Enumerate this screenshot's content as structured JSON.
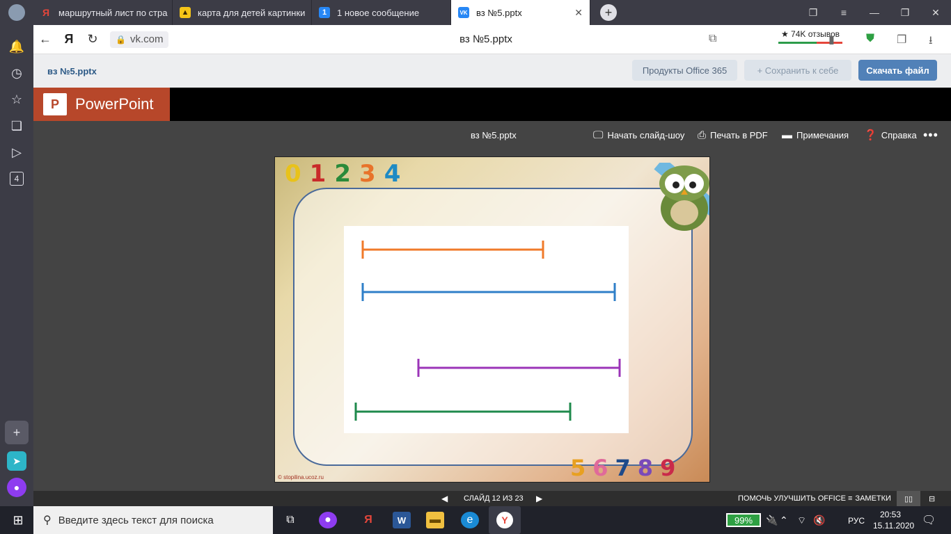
{
  "browser": {
    "tabs": [
      {
        "title": "маршрутный лист по стра",
        "favicon": "yandex-icon",
        "color": "#e5463b",
        "glyph": "Я"
      },
      {
        "title": "карта для детей картинки",
        "favicon": "images-icon",
        "color": "#f5c518",
        "glyph": "▲"
      },
      {
        "title": "1 новое сообщение",
        "favicon": "message-count-icon",
        "color": "#2787f5",
        "glyph": "1"
      },
      {
        "title": "вз №5.pptx",
        "favicon": "vk-icon",
        "color": "#2787f5",
        "glyph": "VK"
      }
    ],
    "url": "vk.com",
    "page_title": "вз №5.pptx",
    "reviews": "★ 74K отзывов"
  },
  "sidebar": {
    "badge_count": "4"
  },
  "vk": {
    "filename": "вз №5.pptx",
    "office_button": "Продукты Office 365",
    "save_button": "+ Сохранить к себе",
    "download_button": "Скачать файл"
  },
  "ppt": {
    "app_name": "PowerPoint",
    "doc_title": "вз №5.pptx",
    "slideshow": "Начать слайд-шоу",
    "print_pdf": "Печать в PDF",
    "notes": "Примечания",
    "help": "Справка",
    "slide_counter": "СЛАЙД 12 ИЗ 23",
    "improve_office": "ПОМОЧЬ УЛУЧШИТЬ OFFICE",
    "notes_toggle": "ЗАМЕТКИ"
  },
  "slide": {
    "top_digits": [
      "0",
      "1",
      "2",
      "3",
      "4"
    ],
    "bottom_digits": [
      "5",
      "6",
      "7",
      "8",
      "9"
    ],
    "watermark": "© stopilina.ucoz.ru",
    "segments": [
      {
        "color": "#f07a2a"
      },
      {
        "color": "#2f7fc8"
      },
      {
        "color": "#9b35b8"
      },
      {
        "color": "#1f8a4c"
      }
    ]
  },
  "taskbar": {
    "search_placeholder": "Введите здесь текст для поиска",
    "battery": "99%",
    "language": "РУС",
    "time": "20:53",
    "date": "15.11.2020"
  }
}
